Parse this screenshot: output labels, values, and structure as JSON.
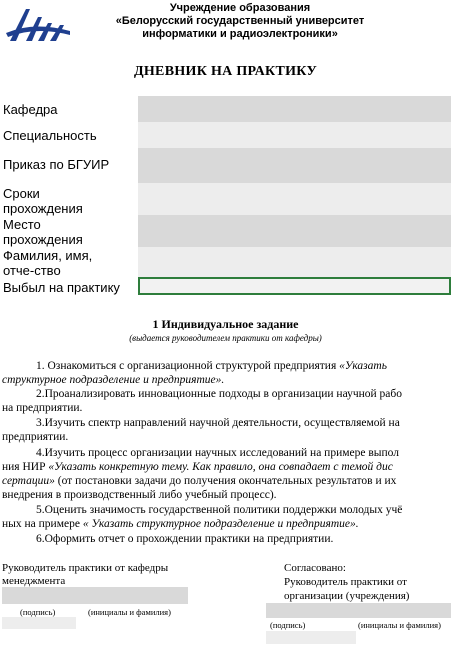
{
  "header": {
    "logo": "buir-logo-icon",
    "line1": "Учреждение образования",
    "line2": "«Белорусский государственный университет",
    "line3": "информатики и радиоэлектроники»"
  },
  "title": "ДНЕВНИК НА ПРАКТИКУ",
  "form": {
    "department": "Кафедра",
    "specialty": "Специальность",
    "order": "Приказ по БГУИР",
    "terms_1": "Сроки",
    "terms_2": "прохождения",
    "place_1": "Место",
    "place_2": "прохождения",
    "name_1": "Фамилия, имя,",
    "name_2": "отче-ство",
    "issued": "Выбыл на практику"
  },
  "section": {
    "title": "1 Индивидуальное задание",
    "subtitle": "(выдается руководителем практики от кафедры)"
  },
  "tasks": {
    "t1a": "1. Ознакомиться с организационной структурой предприятия ",
    "t1b": "«Указать",
    "t1c": "структурное подразделение и предприятие».",
    "t2a": "2.Проанализировать инновационные подходы в организации научной рабо",
    "t2b": "на предприятии.",
    "t3a": "3.Изучить спектр направлений научной деятельности, осуществляемой на",
    "t3b": "предприятии.",
    "t4a": "4.Изучить процесс организации научных исследований на примере выпол",
    "t4b": "ния НИР ",
    "t4c": "«Указать конкретную тему. Как правило, она совпадает с темой дис",
    "t4d": "сертации»",
    "t4e": " (от постановки задачи до получения окончательных результатов и их",
    "t4f": "внедрения в производственный либо учебный процесс).",
    "t5a": "5.Оценить значимость государственной политики поддержки молодых учё",
    "t5b": "ных на примере ",
    "t5c": "« Указать структурное подразделение и предприятие».",
    "t6": "6.Оформить отчет о прохождении практики на предприятии."
  },
  "signatures": {
    "left_1": "Руководитель практики от кафедры",
    "left_2": "менеджмента",
    "left_cap_sign": "(подпись)",
    "left_cap_name": "(инициалы и фамилия)",
    "right_1": "Согласовано:",
    "right_2": "Руководитель практики от",
    "right_3": "организации (учреждения)",
    "right_cap_sign": "(подпись)",
    "right_cap_name": "(инициалы и фамилия)"
  },
  "colors": {
    "logo": "#1f3f8f",
    "field_gray": "#d9d9d9",
    "field_light": "#ededed",
    "selection": "#2e7d3c"
  }
}
